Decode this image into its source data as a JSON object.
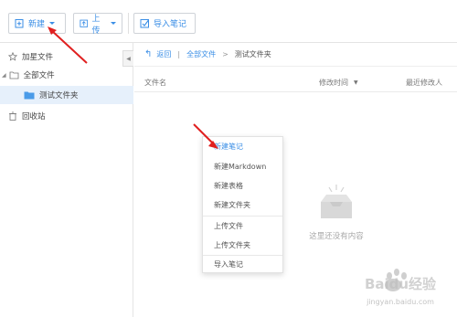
{
  "toolbar": {
    "new_label": "新建",
    "upload_label": "上传",
    "import_label": "导入笔记"
  },
  "sidebar": {
    "items": [
      {
        "label": "加星文件",
        "icon": "star-icon"
      },
      {
        "label": "全部文件",
        "icon": "folder-icon"
      },
      {
        "label": "测试文件夹",
        "icon": "folder-icon"
      },
      {
        "label": "回收站",
        "icon": "trash-icon"
      }
    ]
  },
  "breadcrumb": {
    "back": "返回",
    "all_files": "全部文件",
    "current": "测试文件夹"
  },
  "columns": {
    "name": "文件名",
    "modified_time": "修改时间",
    "modifier": "最近修改人"
  },
  "empty_state": {
    "text": "这里还没有内容"
  },
  "new_menu": {
    "items": [
      "新建笔记",
      "新建Markdown",
      "新建表格",
      "新建文件夹",
      "上传文件",
      "上传文件夹",
      "导入笔记"
    ]
  },
  "watermark": {
    "brand": "Baidu经验",
    "url": "jingyan.baidu.com"
  },
  "colors": {
    "accent": "#3a8ee6",
    "annotation_arrow": "#e02020",
    "sidebar_active": "#e6f0fb"
  }
}
